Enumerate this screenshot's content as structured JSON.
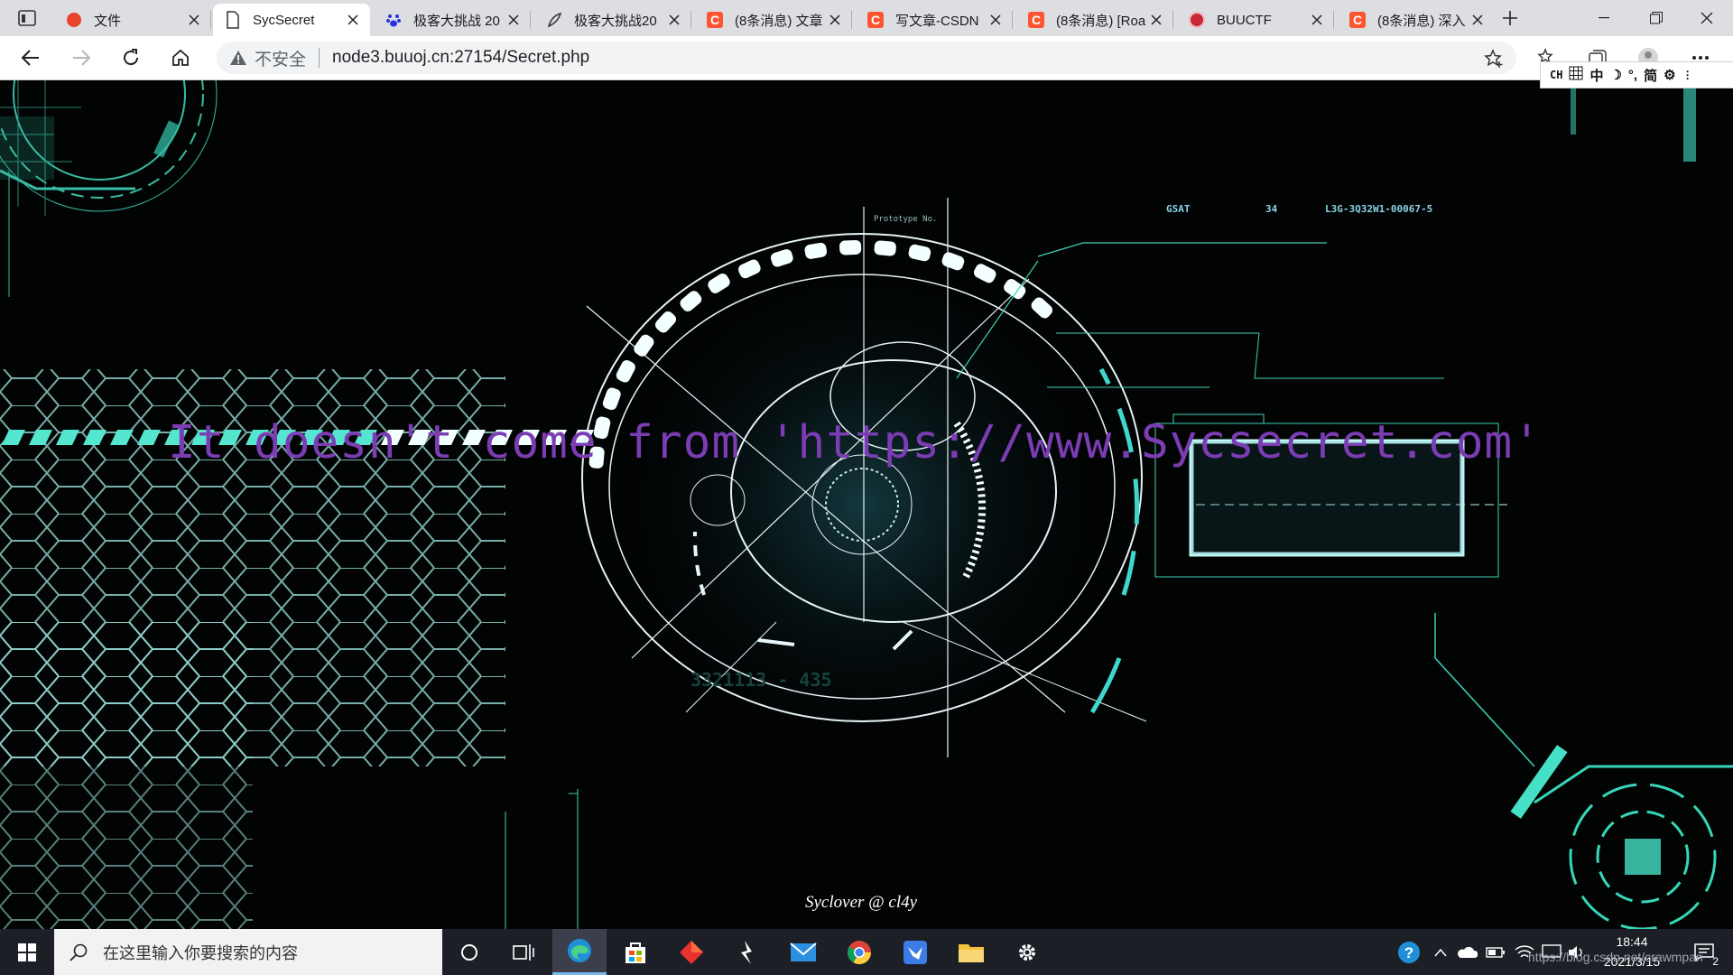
{
  "browser": {
    "tabs": [
      {
        "title": "文件",
        "favicon": "dingtalk-icon"
      },
      {
        "title": "SycSecret",
        "favicon": "page-icon"
      },
      {
        "title": "极客大挑战 20",
        "favicon": "baidu-paw-icon"
      },
      {
        "title": "极客大挑战20",
        "favicon": "feather-icon"
      },
      {
        "title": "(8条消息) 文章",
        "favicon": "csdn-icon"
      },
      {
        "title": "写文章-CSDN",
        "favicon": "csdn-icon"
      },
      {
        "title": "(8条消息) [Roa",
        "favicon": "csdn-icon"
      },
      {
        "title": "BUUCTF",
        "favicon": "buuctf-icon"
      },
      {
        "title": "(8条消息) 深入",
        "favicon": "csdn-icon"
      }
    ],
    "active_tab": "SycSecret",
    "security_label": "不安全",
    "url": "node3.buuoj.cn:27154/Secret.php"
  },
  "ime": {
    "mode": "CH",
    "chars": [
      "中",
      "简"
    ]
  },
  "page": {
    "headline": "It doesn't come from 'https://www.Sycsecret.com'",
    "credit": "Syclover @ cl4y",
    "headline_color": "#7b3cb4",
    "hud_labels": {
      "gsat": "GSAT",
      "num": "34",
      "code": "L3G-3Q32W1-00067-5",
      "proto": "Prototype No.",
      "serial": "3321113 - 435"
    }
  },
  "taskbar": {
    "search_placeholder": "在这里输入你要搜索的内容",
    "time": "18:44",
    "date": "2021/3/15",
    "notification_count": "2",
    "watermark": "https://blog.csdn.net/crawmpan"
  },
  "colors": {
    "accent_cyan": "#48e0c8",
    "taskbar": "#1c1f26"
  }
}
